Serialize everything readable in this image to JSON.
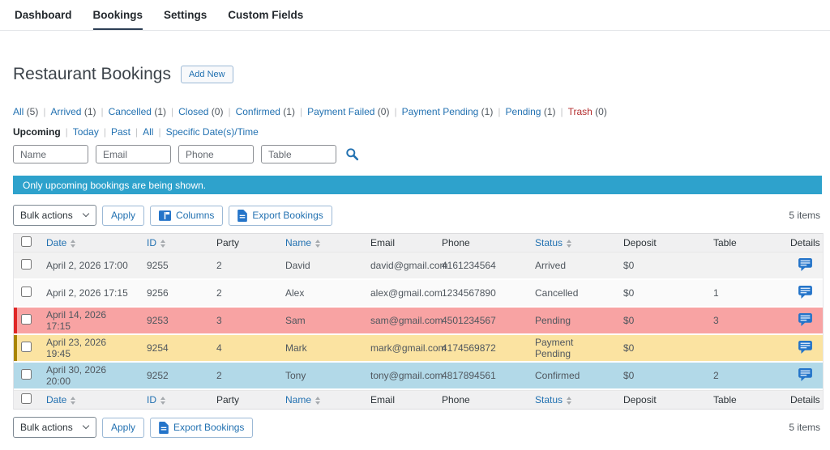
{
  "colors": {
    "link_blue": "#2271b1",
    "trash_red": "#b32d2e",
    "notice_bg": "#2ea2cc",
    "row_red_bg": "#f8a3a3",
    "row_red_border": "#df2727",
    "row_yellow_bg": "#fbe3a1",
    "row_yellow_border": "#a98500",
    "row_blue_bg": "#b2d9e8",
    "icon_blue": "#2474c9"
  },
  "nav": {
    "items": [
      {
        "label": "Dashboard",
        "active": false
      },
      {
        "label": "Bookings",
        "active": true
      },
      {
        "label": "Settings",
        "active": false
      },
      {
        "label": "Custom Fields",
        "active": false
      }
    ]
  },
  "header": {
    "title": "Restaurant Bookings",
    "add_new_label": "Add New"
  },
  "status_filters": [
    {
      "label": "All",
      "count": "(5)"
    },
    {
      "label": "Arrived",
      "count": "(1)"
    },
    {
      "label": "Cancelled",
      "count": "(1)"
    },
    {
      "label": "Closed",
      "count": "(0)"
    },
    {
      "label": "Confirmed",
      "count": "(1)"
    },
    {
      "label": "Payment Failed",
      "count": "(0)"
    },
    {
      "label": "Payment Pending",
      "count": "(1)"
    },
    {
      "label": "Pending",
      "count": "(1)"
    },
    {
      "label": "Trash",
      "count": "(0)",
      "danger": true
    }
  ],
  "view_filters": [
    {
      "label": "Upcoming",
      "current": true
    },
    {
      "label": "Today"
    },
    {
      "label": "Past"
    },
    {
      "label": "All"
    },
    {
      "label": "Specific Date(s)/Time"
    }
  ],
  "search": {
    "fields": [
      {
        "placeholder": "Name"
      },
      {
        "placeholder": "Email"
      },
      {
        "placeholder": "Phone"
      },
      {
        "placeholder": "Table"
      }
    ]
  },
  "notice": {
    "text": "Only upcoming bookings are being shown."
  },
  "toolbar_top": {
    "bulk_actions_label": "Bulk actions",
    "apply_label": "Apply",
    "columns_label": "Columns",
    "export_label": "Export Bookings",
    "items_count": "5 items"
  },
  "table": {
    "columns": [
      {
        "label": "Date",
        "sortable": true
      },
      {
        "label": "ID",
        "sortable": true
      },
      {
        "label": "Party",
        "sortable": false
      },
      {
        "label": "Name",
        "sortable": true
      },
      {
        "label": "Email",
        "sortable": false
      },
      {
        "label": "Phone",
        "sortable": false
      },
      {
        "label": "Status",
        "sortable": true
      },
      {
        "label": "Deposit",
        "sortable": false
      },
      {
        "label": "Table",
        "sortable": false
      },
      {
        "label": "Details",
        "sortable": false
      }
    ],
    "rows": [
      {
        "date": "April 2, 2026 17:00",
        "id": "9255",
        "party": "2",
        "name": "David",
        "email": "david@gmail.com",
        "phone": "4161234564",
        "status": "Arrived",
        "deposit": "$0",
        "table": "",
        "highlight": "none"
      },
      {
        "date": "April 2, 2026 17:15",
        "id": "9256",
        "party": "2",
        "name": "Alex",
        "email": "alex@gmail.com",
        "phone": "1234567890",
        "status": "Cancelled",
        "deposit": "$0",
        "table": "1",
        "highlight": "none"
      },
      {
        "date": "April 14, 2026 17:15",
        "id": "9253",
        "party": "3",
        "name": "Sam",
        "email": "sam@gmail.com",
        "phone": "4501234567",
        "status": "Pending",
        "deposit": "$0",
        "table": "3",
        "highlight": "red"
      },
      {
        "date": "April 23, 2026 19:45",
        "id": "9254",
        "party": "4",
        "name": "Mark",
        "email": "mark@gmail.com",
        "phone": "4174569872",
        "status": "Payment Pending",
        "deposit": "$0",
        "table": "",
        "highlight": "yellow"
      },
      {
        "date": "April 30, 2026 20:00",
        "id": "9252",
        "party": "2",
        "name": "Tony",
        "email": "tony@gmail.com",
        "phone": "4817894561",
        "status": "Confirmed",
        "deposit": "$0",
        "table": "2",
        "highlight": "blue"
      }
    ]
  },
  "toolbar_bottom": {
    "bulk_actions_label": "Bulk actions",
    "apply_label": "Apply",
    "export_label": "Export Bookings",
    "items_count": "5 items"
  }
}
